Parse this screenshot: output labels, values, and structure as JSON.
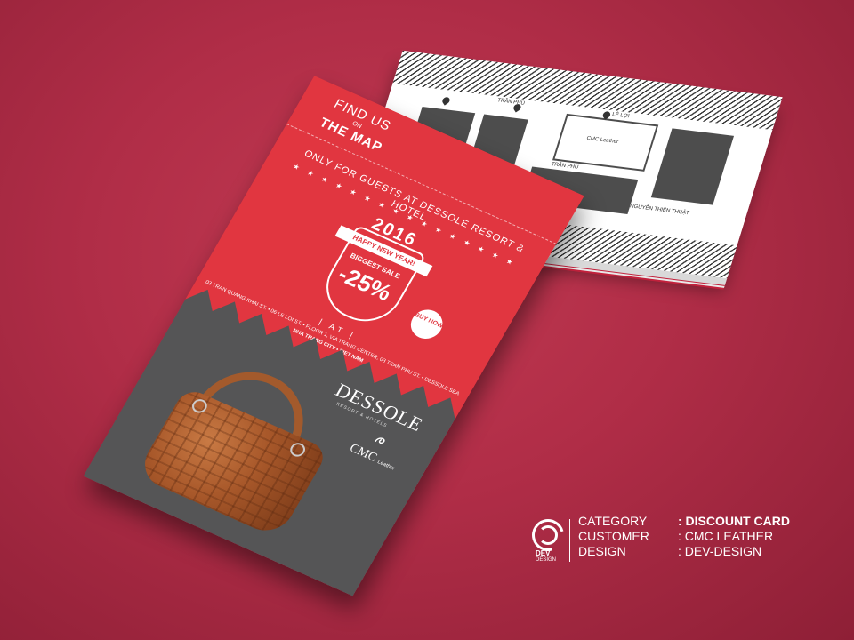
{
  "colors": {
    "background": "#b02d47",
    "card_red": "#e13640",
    "card_grey": "#555556",
    "text": "#ffffff"
  },
  "front_card": {
    "find_us": "FIND US",
    "on": "ON",
    "the_map": "THE MAP",
    "only_for_guests": "ONLY FOR GUESTS AT DESSOLE RESORT & HOTEL",
    "stars": "★ ★ ★ ★ ★ ★ ★ ★ ★ ★ ★ ★ ★ ★ ★ ★",
    "year": "2016",
    "happy_new_year": "HAPPY NEW YEAR!",
    "biggest_sale": "BIGGEST SALE",
    "discount": "-25%",
    "buy_now": "BUY NOW",
    "at": "| AT |",
    "address_line_1": "03 TRAN QUANG KHAI ST. • 06 LE LOI ST. • FLOOR 1, VIA TRANG CENTER, 03 TRAN PHU ST. • DESSOLE SEA BEACH ST.",
    "address_line_2": "NHA TRANG CITY • VIET NAM",
    "brand_dessole": "DESSOLE",
    "brand_dessole_sub": "RESORT & HOTELS",
    "brand_cmc": "CMC",
    "brand_cmc_sub": "Leather"
  },
  "back_card": {
    "map_labels": [
      "TRẦN PHÚ",
      "LÊ LỢI",
      "CMC Leather",
      "TRẦN PHÚ",
      "NGUYỄN THIỆN THUẬT"
    ]
  },
  "info": {
    "logo_text": "DEV",
    "logo_sub": "DESIGN",
    "labels": [
      "CATEGORY",
      "CUSTOMER",
      "DESIGN"
    ],
    "values": [
      ": DISCOUNT CARD",
      ": CMC LEATHER",
      ": DEV-DESIGN"
    ]
  }
}
